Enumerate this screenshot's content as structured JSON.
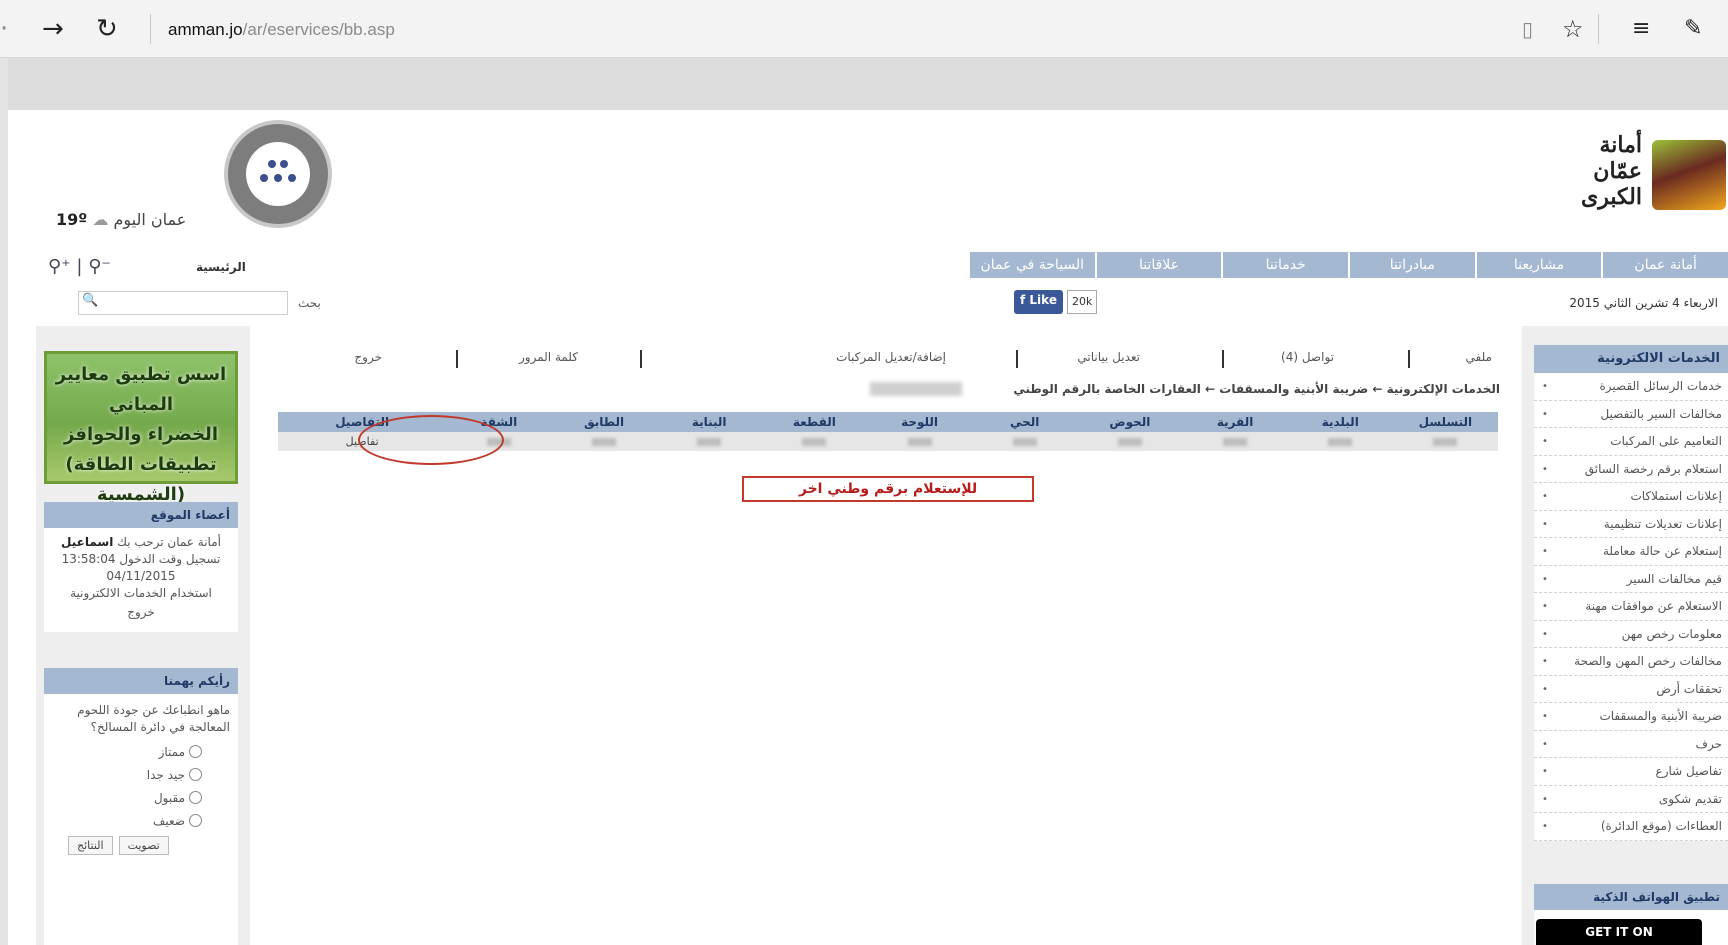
{
  "browser": {
    "url_host": "amman.jo",
    "url_path": "/ar/eservices/bb.asp",
    "icons": [
      "back-arrow-icon",
      "forward-arrow-icon",
      "refresh-icon",
      "reading-view-icon",
      "favorite-star-icon",
      "hub-menu-icon",
      "web-note-icon"
    ]
  },
  "header": {
    "logo_lines": [
      "أمانة",
      "عمّان",
      "الكبرى"
    ],
    "weather_label": "عمان اليوم",
    "weather_temp": "19º",
    "home_label": "الرئيسية",
    "nav": [
      "أمانة عمان",
      "مشاريعنا",
      "مبادراتنا",
      "خدماتنا",
      "علاقاتنا",
      "السياحة في عمان"
    ],
    "date": "الاربعاء 4 تشرين الثاني 2015",
    "fb_like": "Like",
    "fb_count": "20k",
    "search_label": "بحث",
    "search_placeholder": ""
  },
  "sidebar": {
    "title": "الخدمات الالكترونية",
    "items": [
      "خدمات الرسائل القصيرة",
      "مخالفات السير بالتفصيل",
      "التعاميم على المركبات",
      "استعلام برقم رخصة السائق",
      "إعلانات استملاكات",
      "إعلانات تعديلات تنظيمية",
      "إستعلام عن حالة معاملة",
      "قيم مخالفات السير",
      "الاستعلام عن موافقات مهنة",
      "معلومات رخص مهن",
      "مخالفات رخص المهن والصحة",
      "تحققات أرض",
      "ضريبة الأبنية والمسقفات",
      "حرف",
      "تفاصيل شارع",
      "تقديم شكوى",
      "العطاءات (موقع الدائرة)"
    ],
    "app_title": "تطبيق الهواتف الذكية",
    "app_button": "GET IT ON"
  },
  "left": {
    "banner_lines": [
      "اسس تطبيق معايير المباني",
      "الخضراء والحوافز",
      "(تطبيقات الطاقة الشمسية)"
    ],
    "members_title": "أعضاء الموقع",
    "welcome": "أمانة عمان ترحب بك",
    "username": "اسماعيل",
    "login_time_label": "تسجيل وقت الدخول",
    "login_time": "13:58:04",
    "login_date": "04/11/2015",
    "usage": "استخدام الخدمات الالكترونية",
    "logout": "خروج",
    "poll_title": "رأيكم يهمنا",
    "poll_question": "ماهو انطباعك عن جودة اللحوم المعالجة في دائرة المسالخ؟",
    "poll_options": [
      "ممتاز",
      "جيد جدا",
      "مقبول",
      "ضعيف"
    ],
    "vote_button": "تصويت",
    "results_button": "النتائج"
  },
  "main": {
    "menu": [
      "ملفي",
      "تواصل (4)",
      "تعديل بياناتي",
      "إضافة/تعديل المركبات",
      "كلمة المرور",
      "خروج"
    ],
    "breadcrumb": "الخدمات الإلكترونية ← ضريبة الأبنية والمسقفات ← العقارات الخاصة بالرقم الوطني",
    "table_headers": [
      "التسلسل",
      "البلدية",
      "القرية",
      "الحوض",
      "الحي",
      "اللوحة",
      "القطعة",
      "البناية",
      "الطابق",
      "الشقة",
      "التفاصيل"
    ],
    "details_link": "تفاصيل",
    "requery_button": "للإستعلام برقم وطني اخر"
  }
}
